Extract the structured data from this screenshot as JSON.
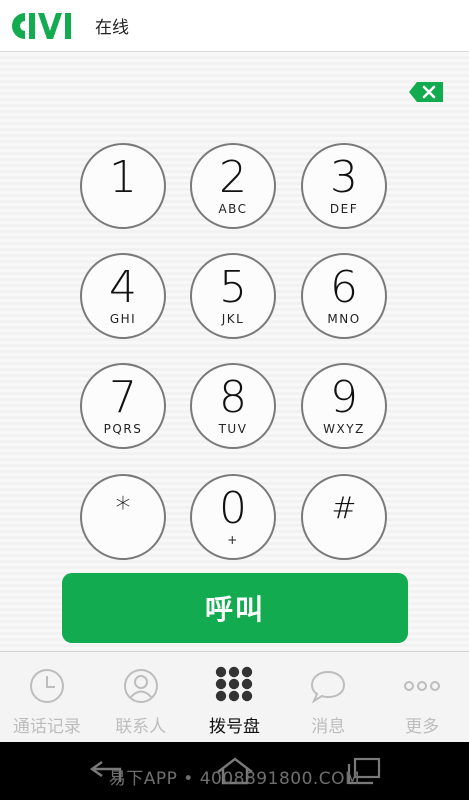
{
  "header": {
    "logo_text": "UIVI",
    "status": "在线"
  },
  "keypad": {
    "keys": [
      {
        "digit": "1",
        "letters": ""
      },
      {
        "digit": "2",
        "letters": "ABC"
      },
      {
        "digit": "3",
        "letters": "DEF"
      },
      {
        "digit": "4",
        "letters": "GHI"
      },
      {
        "digit": "5",
        "letters": "JKL"
      },
      {
        "digit": "6",
        "letters": "MNO"
      },
      {
        "digit": "7",
        "letters": "PQRS"
      },
      {
        "digit": "8",
        "letters": "TUV"
      },
      {
        "digit": "9",
        "letters": "WXYZ"
      },
      {
        "digit": "*",
        "letters": ""
      },
      {
        "digit": "0",
        "letters": "+"
      },
      {
        "digit": "#",
        "letters": ""
      }
    ]
  },
  "call_button": {
    "label": "呼叫"
  },
  "tabs": [
    {
      "label": "通话记录",
      "icon": "clock-icon",
      "active": false
    },
    {
      "label": "联系人",
      "icon": "contact-icon",
      "active": false
    },
    {
      "label": "拨号盘",
      "icon": "dialpad-icon",
      "active": true
    },
    {
      "label": "消息",
      "icon": "chat-bubble-icon",
      "active": false
    },
    {
      "label": "更多",
      "icon": "more-dots-icon",
      "active": false
    }
  ],
  "watermark": "易下APP • 4008891800.COM",
  "colors": {
    "brand_green": "#12ab4f",
    "inactive_tab": "#bdbdbd"
  }
}
